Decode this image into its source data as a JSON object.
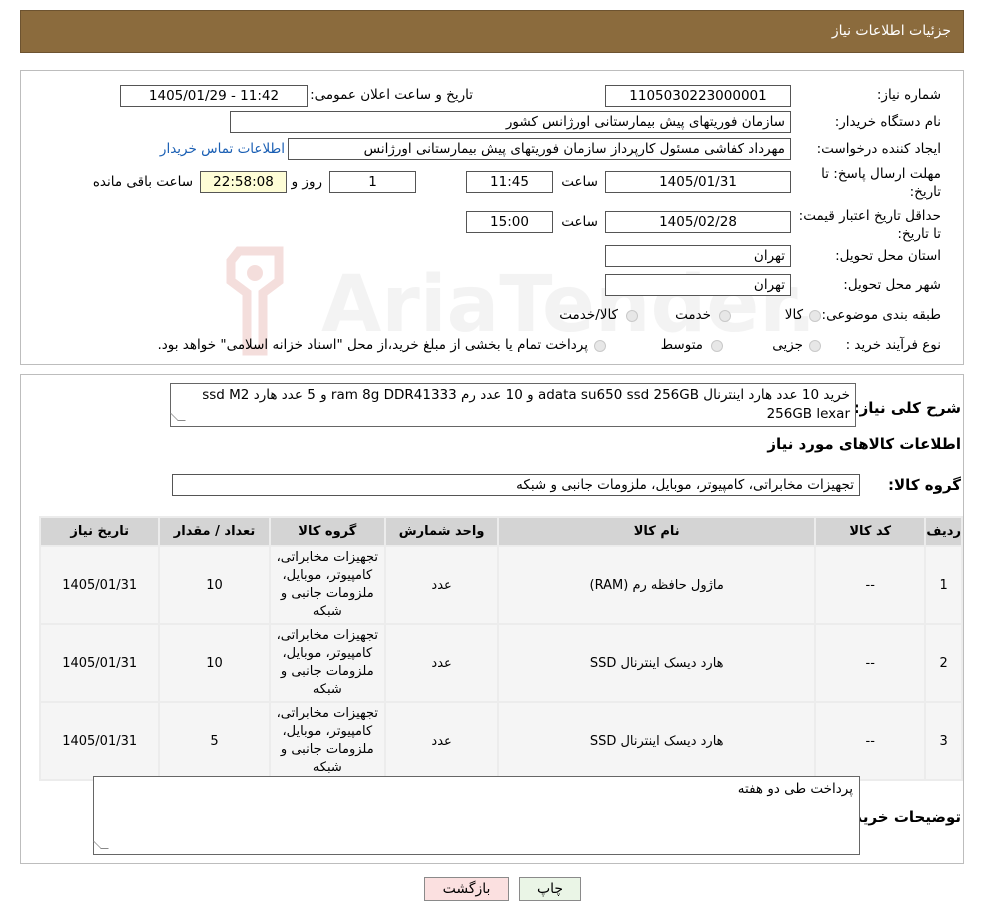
{
  "header": {
    "title": "جزئیات اطلاعات نیاز"
  },
  "info": {
    "need_number_label": "شماره نیاز:",
    "need_number": "1105030223000001",
    "announce_label": "تاریخ و ساعت اعلان عمومی:",
    "announce_value": "1405/01/29 - 11:42",
    "buyer_label": "نام دستگاه خریدار:",
    "buyer_value": "سازمان فوریتهای پیش بیمارستانی اورژانس کشور",
    "creator_label": "ایجاد کننده درخواست:",
    "creator_value": "مهرداد کفاشی مسئول کارپرداز سازمان فوریتهای پیش بیمارستانی اورژانس",
    "contact_link": "اطلاعات تماس خریدار",
    "deadline_label": "مهلت ارسال پاسخ: تا تاریخ:",
    "deadline_date": "1405/01/31",
    "time_label": "ساعت",
    "deadline_time": "11:45",
    "days_value": "1",
    "days_label": "روز و",
    "remaining_value": "22:58:08",
    "remaining_label": "ساعت باقی مانده",
    "validity_label": "حداقل تاریخ اعتبار قیمت: تا تاریخ:",
    "validity_date": "1405/02/28",
    "validity_time": "15:00",
    "province_label": "استان محل تحویل:",
    "province_value": "تهران",
    "city_label": "شهر محل تحویل:",
    "city_value": "تهران",
    "category_label": "طبقه بندی موضوعی:",
    "category_options": [
      "کالا",
      "خدمت",
      "کالا/خدمت"
    ],
    "process_label": "نوع فرآیند خرید :",
    "process_options": [
      "جزیی",
      "متوسط"
    ],
    "process_note": "پرداخت تمام یا بخشی از مبلغ خرید،از محل \"اسناد خزانه اسلامی\" خواهد بود."
  },
  "description": {
    "label": "شرح کلی نیاز:",
    "line1": "خرید 10 عدد هارد اینترنال adata su650 ssd 256GB و 10 عدد رم  ram 8g DDR41333  و 5 عدد هارد ssd M2",
    "line2": "256GB lexar"
  },
  "goods": {
    "section_title": "اطلاعات کالاهای مورد نیاز",
    "group_label": "گروه کالا:",
    "group_value": "تجهیزات مخابراتی، کامپیوتر، موبایل، ملزومات جانبی و شبکه",
    "columns": [
      "ردیف",
      "کد کالا",
      "نام کالا",
      "واحد شمارش",
      "گروه کالا",
      "تعداد / مقدار",
      "تاریخ نیاز"
    ],
    "rows": [
      {
        "row": "1",
        "code": "--",
        "name": "ماژول حافظه رم (RAM)",
        "unit": "عدد",
        "group": "تجهیزات مخابراتی، کامپیوتر، موبایل، ملزومات جانبی و شبکه",
        "qty": "10",
        "date": "1405/01/31"
      },
      {
        "row": "2",
        "code": "--",
        "name": "هارد دیسک اینترنال SSD",
        "unit": "عدد",
        "group": "تجهیزات مخابراتی، کامپیوتر، موبایل، ملزومات جانبی و شبکه",
        "qty": "10",
        "date": "1405/01/31"
      },
      {
        "row": "3",
        "code": "--",
        "name": "هارد دیسک اینترنال SSD",
        "unit": "عدد",
        "group": "تجهیزات مخابراتی، کامپیوتر، موبایل، ملزومات جانبی و شبکه",
        "qty": "5",
        "date": "1405/01/31"
      }
    ]
  },
  "buyer_notes": {
    "label": "توضیحات خریدار:",
    "value": "پرداخت طی دو هفته"
  },
  "buttons": {
    "print": "چاپ",
    "back": "بازگشت"
  },
  "watermark": {
    "text": "AriaTender.neT"
  },
  "colors": {
    "header_bg": "#8b6b3d",
    "remaining_bg": "#fefdd6",
    "back_button_bg": "#fbe0e0",
    "print_button_bg": "#eaf5e6",
    "link": "#1a5fb4"
  }
}
